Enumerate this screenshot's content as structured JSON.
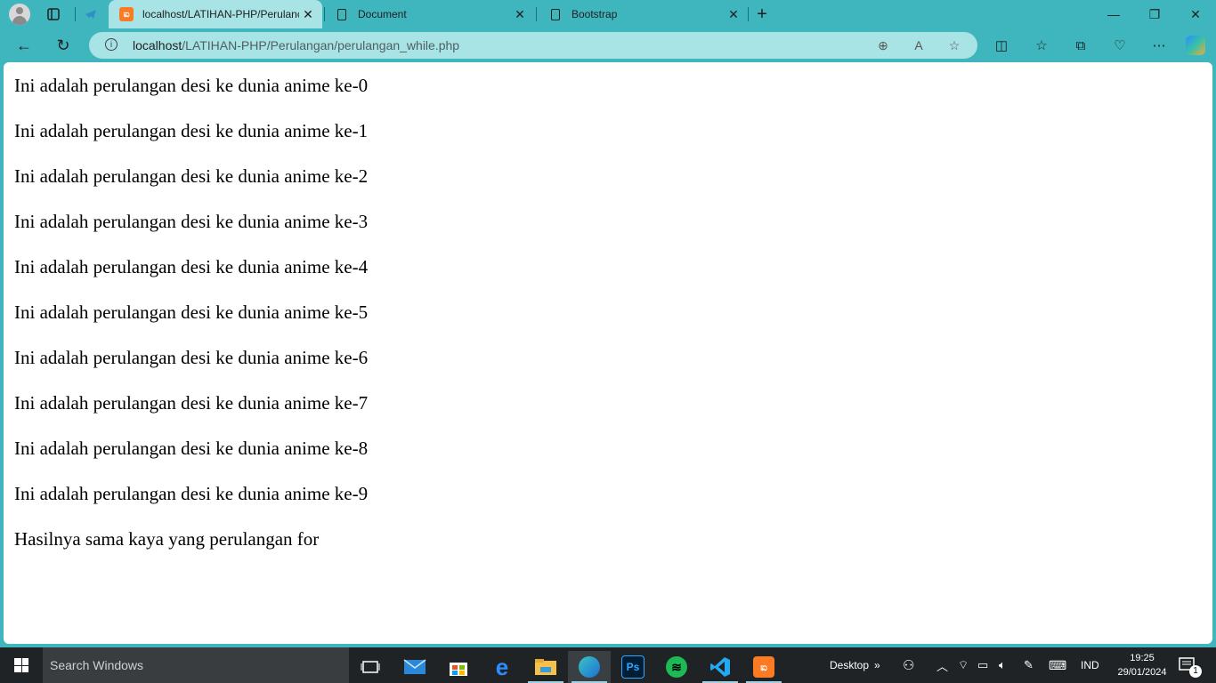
{
  "browser": {
    "tabs": [
      {
        "title": "localhost/LATIHAN-PHP/Perulanc",
        "favicon": "xampp-icon",
        "active": true
      },
      {
        "title": "Document",
        "favicon": "document-icon",
        "active": false
      },
      {
        "title": "Bootstrap",
        "favicon": "document-icon",
        "active": false
      }
    ],
    "new_tab_label": "+",
    "url_host": "localhost",
    "url_path": "/LATIHAN-PHP/Perulangan/perulangan_while.php"
  },
  "page": {
    "lines": [
      "Ini adalah perulangan desi ke dunia anime ke-0",
      "Ini adalah perulangan desi ke dunia anime ke-1",
      "Ini adalah perulangan desi ke dunia anime ke-2",
      "Ini adalah perulangan desi ke dunia anime ke-3",
      "Ini adalah perulangan desi ke dunia anime ke-4",
      "Ini adalah perulangan desi ke dunia anime ke-5",
      "Ini adalah perulangan desi ke dunia anime ke-6",
      "Ini adalah perulangan desi ke dunia anime ke-7",
      "Ini adalah perulangan desi ke dunia anime ke-8",
      "Ini adalah perulangan desi ke dunia anime ke-9",
      "Hasilnya sama kaya yang perulangan for"
    ]
  },
  "taskbar": {
    "search_placeholder": "Search Windows",
    "desktop_label": "Desktop",
    "language": "IND",
    "time": "19:25",
    "date": "29/01/2024",
    "notification_count": "1"
  },
  "colors": {
    "accent": "#3fb6bd",
    "tab_active": "#a8e3e6",
    "taskbar": "#1f2326"
  }
}
